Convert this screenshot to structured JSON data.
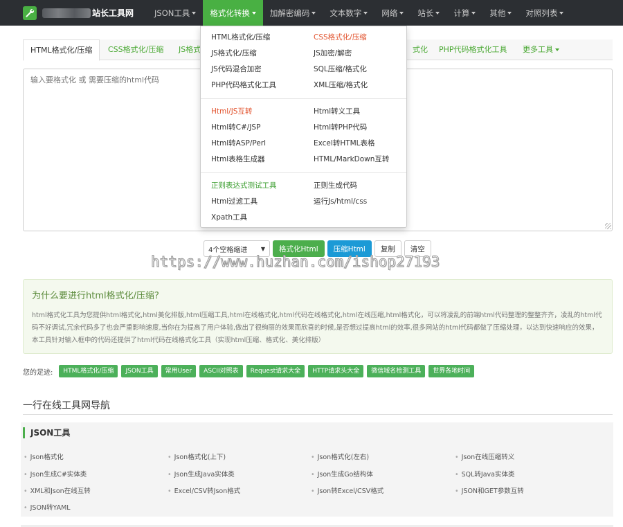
{
  "navbar": {
    "brand_name": "站长工具网",
    "items": [
      {
        "label": "JSON工具"
      },
      {
        "label": "格式化转换"
      },
      {
        "label": "加解密编码"
      },
      {
        "label": "文本数字"
      },
      {
        "label": "网络"
      },
      {
        "label": "站长"
      },
      {
        "label": "计算"
      },
      {
        "label": "其他"
      },
      {
        "label": "对照列表"
      }
    ]
  },
  "dropdown": {
    "group1": [
      "HTML格式化/压缩",
      "CSS格式化/压缩",
      "JS格式化/压缩",
      "JS加密/解密",
      "JS代码混合加密",
      "SQL压缩/格式化",
      "PHP代码格式化工具",
      "XML压缩/格式化"
    ],
    "group2": [
      "Html/JS互转",
      "Html转义工具",
      "Html转C#/JSP",
      "Html转PHP代码",
      "Html转ASP/Perl",
      "Excel转HTML表格",
      "Html表格生成器",
      "HTML/MarkDown互转"
    ],
    "group3": [
      "正则表达式测试工具",
      "正则生成代码",
      "Html过滤工具",
      "运行Js/html/css",
      "Xpath工具"
    ]
  },
  "tabs": [
    {
      "label": "HTML格式化/压缩"
    },
    {
      "label": "CSS格式化/压缩"
    },
    {
      "label": "JS格式"
    },
    {
      "label": "式化"
    },
    {
      "label": "PHP代码格式化工具"
    },
    {
      "label": "更多工具"
    }
  ],
  "editor": {
    "placeholder": "输入要格式化 或 需要压缩的html代码"
  },
  "actions": {
    "indent_select": "4个空格缩进",
    "format_button": "格式化Html",
    "compress_button": "压缩Html",
    "copy_button": "复制",
    "clear_button": "清空"
  },
  "watermark": "https://www.huzhan.com/ishop27193",
  "info": {
    "title": "为什么要进行html格式化/压缩?",
    "text": "html格式化工具为您提供html格式化,html美化排版,html压缩工具,html在线格式化,html代码在线格式化,html在线压缩,html格式化，可以将凌乱的前端html代码整理的整整齐齐，凌乱的html代码不好调试,冗余代码多了也会严重影响速度,当你在为提高了用户体验,做出了很绚丽的效果而欣喜的时候,是否想过提高html的效率,很多网站的html代码都做了压缩处理，以达到快速响应的效果，本工具针对输入框中的代码还提供了html代码在线格式化工具（实现html压缩、格式化、美化排版）"
  },
  "footprint": {
    "label": "您的足迹:",
    "tags": [
      "HTML格式化/压缩",
      "JSON工具",
      "常用User",
      "ASCII对照表",
      "Request请求大全",
      "HTTP请求头大全",
      "微信域名检测工具",
      "世界各地时间"
    ]
  },
  "nav_section": {
    "title": "一行在线工具网导航",
    "panel_title": "JSON工具",
    "links": [
      "Json格式化",
      "Json格式化(上下)",
      "Json格式化(左右)",
      "Json在线压缩转义",
      "Json生成C#实体类",
      "Json生成Java实体类",
      "Json生成Go结构体",
      "SQL转Java实体类",
      "XML和Json在线互转",
      "Excel/CSV转Json格式",
      "Json转Excel/CSV格式",
      "JSON和GET参数互转",
      "JSON转YAML"
    ]
  },
  "colors": {
    "navbar_bg": "#2c2f33",
    "accent_green": "#49b043",
    "accent_blue": "#1b9ad6",
    "highlight_red": "#e2542f"
  },
  "icons": {
    "brand": "wrench-icon"
  }
}
